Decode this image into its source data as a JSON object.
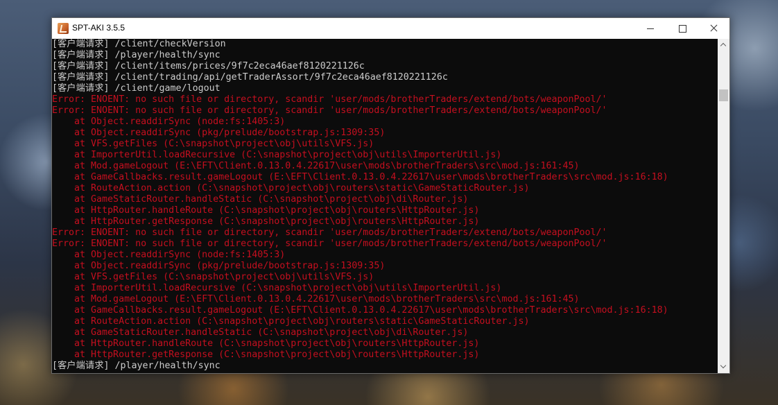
{
  "window": {
    "title": "SPT-AKI 3.5.5",
    "icon": "spt-aki-app-icon"
  },
  "colors": {
    "info_text": "#cccccc",
    "error_text": "#c50f1f",
    "console_bg": "#0c0c0c",
    "titlebar_bg": "#ffffff"
  },
  "console": {
    "lines": [
      {
        "text": "[客户端请求] /client/checkVersion",
        "type": "info"
      },
      {
        "text": "[客户端请求] /player/health/sync",
        "type": "info"
      },
      {
        "text": "[客户端请求] /client/items/prices/9f7c2eca46aef8120221126c",
        "type": "info"
      },
      {
        "text": "[客户端请求] /client/trading/api/getTraderAssort/9f7c2eca46aef8120221126c",
        "type": "info"
      },
      {
        "text": "[客户端请求] /client/game/logout",
        "type": "info"
      },
      {
        "text": "Error: ENOENT: no such file or directory, scandir 'user/mods/brotherTraders/extend/bots/weaponPool/'",
        "type": "error"
      },
      {
        "text": "Error: ENOENT: no such file or directory, scandir 'user/mods/brotherTraders/extend/bots/weaponPool/'",
        "type": "error"
      },
      {
        "text": "    at Object.readdirSync (node:fs:1405:3)",
        "type": "error"
      },
      {
        "text": "    at Object.readdirSync (pkg/prelude/bootstrap.js:1309:35)",
        "type": "error"
      },
      {
        "text": "    at VFS.getFiles (C:\\snapshot\\project\\obj\\utils\\VFS.js)",
        "type": "error"
      },
      {
        "text": "    at ImporterUtil.loadRecursive (C:\\snapshot\\project\\obj\\utils\\ImporterUtil.js)",
        "type": "error"
      },
      {
        "text": "    at Mod.gameLogout (E:\\EFT\\Client.0.13.0.4.22617\\user\\mods\\brotherTraders\\src\\mod.js:161:45)",
        "type": "error"
      },
      {
        "text": "    at GameCallbacks.result.gameLogout (E:\\EFT\\Client.0.13.0.4.22617\\user\\mods\\brotherTraders\\src\\mod.js:16:18)",
        "type": "error"
      },
      {
        "text": "    at RouteAction.action (C:\\snapshot\\project\\obj\\routers\\static\\GameStaticRouter.js)",
        "type": "error"
      },
      {
        "text": "    at GameStaticRouter.handleStatic (C:\\snapshot\\project\\obj\\di\\Router.js)",
        "type": "error"
      },
      {
        "text": "    at HttpRouter.handleRoute (C:\\snapshot\\project\\obj\\routers\\HttpRouter.js)",
        "type": "error"
      },
      {
        "text": "    at HttpRouter.getResponse (C:\\snapshot\\project\\obj\\routers\\HttpRouter.js)",
        "type": "error"
      },
      {
        "text": "Error: ENOENT: no such file or directory, scandir 'user/mods/brotherTraders/extend/bots/weaponPool/'",
        "type": "error"
      },
      {
        "text": "Error: ENOENT: no such file or directory, scandir 'user/mods/brotherTraders/extend/bots/weaponPool/'",
        "type": "error"
      },
      {
        "text": "    at Object.readdirSync (node:fs:1405:3)",
        "type": "error"
      },
      {
        "text": "    at Object.readdirSync (pkg/prelude/bootstrap.js:1309:35)",
        "type": "error"
      },
      {
        "text": "    at VFS.getFiles (C:\\snapshot\\project\\obj\\utils\\VFS.js)",
        "type": "error"
      },
      {
        "text": "    at ImporterUtil.loadRecursive (C:\\snapshot\\project\\obj\\utils\\ImporterUtil.js)",
        "type": "error"
      },
      {
        "text": "    at Mod.gameLogout (E:\\EFT\\Client.0.13.0.4.22617\\user\\mods\\brotherTraders\\src\\mod.js:161:45)",
        "type": "error"
      },
      {
        "text": "    at GameCallbacks.result.gameLogout (E:\\EFT\\Client.0.13.0.4.22617\\user\\mods\\brotherTraders\\src\\mod.js:16:18)",
        "type": "error"
      },
      {
        "text": "    at RouteAction.action (C:\\snapshot\\project\\obj\\routers\\static\\GameStaticRouter.js)",
        "type": "error"
      },
      {
        "text": "    at GameStaticRouter.handleStatic (C:\\snapshot\\project\\obj\\di\\Router.js)",
        "type": "error"
      },
      {
        "text": "    at HttpRouter.handleRoute (C:\\snapshot\\project\\obj\\routers\\HttpRouter.js)",
        "type": "error"
      },
      {
        "text": "    at HttpRouter.getResponse (C:\\snapshot\\project\\obj\\routers\\HttpRouter.js)",
        "type": "error"
      },
      {
        "text": "[客户端请求] /player/health/sync",
        "type": "info"
      }
    ]
  }
}
